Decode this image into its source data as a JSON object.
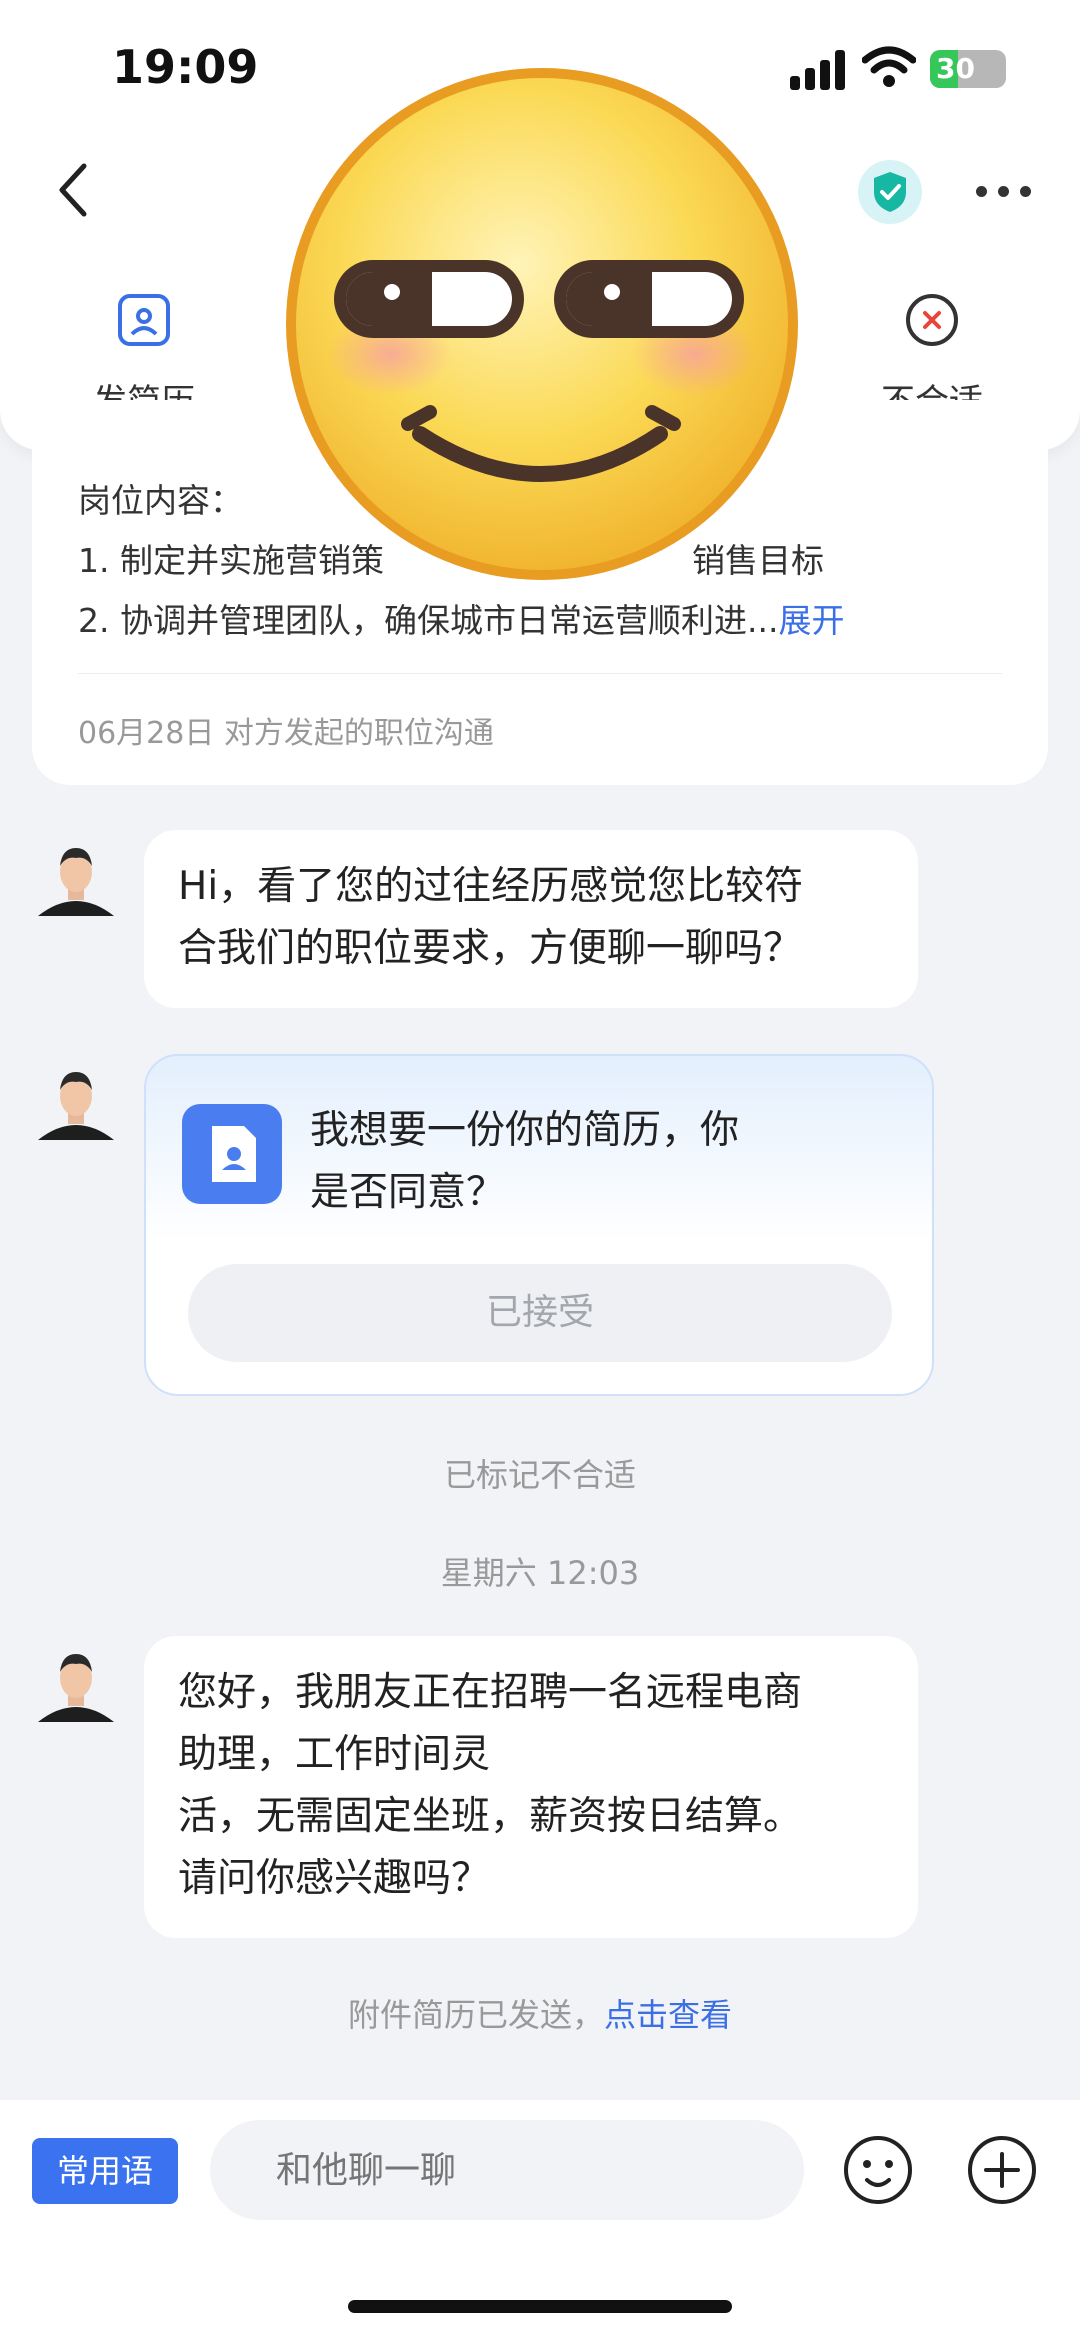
{
  "status_bar": {
    "time": "19:09",
    "battery": "30"
  },
  "header": {
    "actions": [
      {
        "label": "发简历",
        "icon": "resume-icon"
      },
      {
        "label": "不合适",
        "icon": "close-circle-icon"
      }
    ]
  },
  "job_card": {
    "title": "岗位内容：",
    "line1": "1. 制定并实施营销策",
    "line1_tail": "销售目标",
    "line2": "2. 协调并管理团队，确保城市日常运营顺利进...",
    "expand": "展开",
    "meta": "06月28日  对方发起的职位沟通"
  },
  "messages": {
    "msg1": [
      "Hi，看了您的过往经历感觉您比较符",
      "合我们的职位要求，方便聊一聊吗？"
    ],
    "resume_request": {
      "line1": "我想要一份你的简历，你",
      "line2": "是否同意？",
      "button": "已接受"
    },
    "note_unfit": "已标记不合适",
    "timestamp": "星期六 12:03",
    "msg2": [
      "您好，我朋友正在招聘一名远程电商",
      "助理，工作时间灵",
      "活，无需固定坐班，薪资按日结算。",
      "请问你感兴趣吗？"
    ],
    "resume_sent": {
      "text": "附件简历已发送，",
      "link": "点击查看"
    }
  },
  "bottom_bar": {
    "phrase_button": "常用语",
    "input_placeholder": "和他聊一聊"
  },
  "colors": {
    "accent": "#3a72f0",
    "link": "#3a6fe6",
    "background": "#f1f3f7"
  }
}
